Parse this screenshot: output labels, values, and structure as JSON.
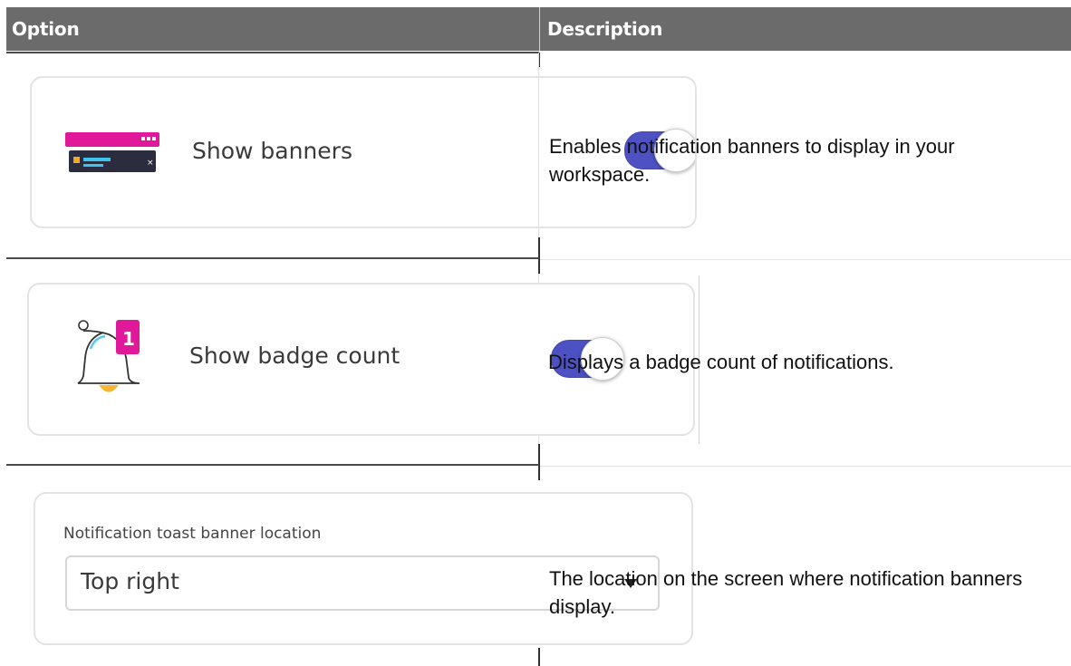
{
  "header": {
    "option_label": "Option",
    "description_label": "Description"
  },
  "rows": [
    {
      "option_label": "Show banners",
      "description": "Enables notification banners to display in your workspace.",
      "toggle_on": true
    },
    {
      "option_label": "Show badge count",
      "badge_number": "1",
      "description": "Displays a badge count of notifications.",
      "toggle_on": true
    },
    {
      "field_label": "Notification toast banner location",
      "selected_value": "Top right",
      "description": "The location on the screen where notification banners display."
    }
  ],
  "colors": {
    "toggle_on": "#4d51c4",
    "banner_accent": "#e0189a",
    "header_bg": "#6b6b6b",
    "bell_badge": "#e0189a"
  },
  "icons": [
    "banner-icon",
    "bell-icon",
    "dropdown-arrow-icon"
  ]
}
